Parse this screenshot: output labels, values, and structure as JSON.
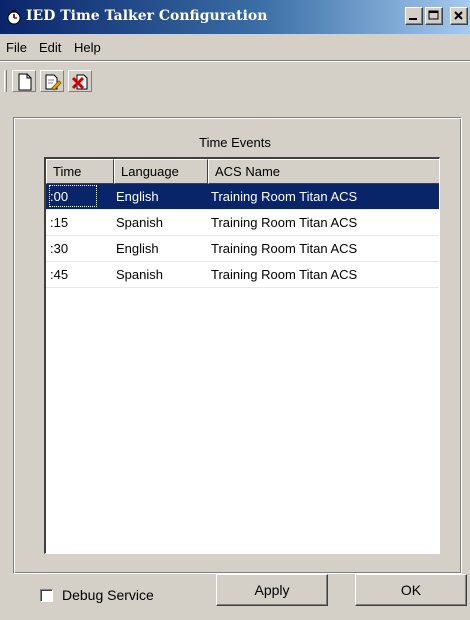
{
  "window": {
    "title": "IED Time Talker Configuration",
    "icon": "clock-app-icon",
    "controls": [
      "minimize",
      "maximize",
      "close"
    ]
  },
  "menu": [
    "File",
    "Edit",
    "Help"
  ],
  "toolbar": {
    "buttons": [
      "new-document-icon",
      "edit-document-icon",
      "delete-document-icon"
    ]
  },
  "events": {
    "title": "Time Events",
    "columns": [
      "Time",
      "Language",
      "ACS Name"
    ],
    "rows": [
      {
        "time": ":00",
        "language": "English",
        "acs": "Training Room Titan ACS",
        "selected": true
      },
      {
        "time": ":15",
        "language": "Spanish",
        "acs": "Training Room Titan ACS",
        "selected": false
      },
      {
        "time": ":30",
        "language": "English",
        "acs": "Training Room Titan ACS",
        "selected": false
      },
      {
        "time": ":45",
        "language": "Spanish",
        "acs": "Training Room Titan ACS",
        "selected": false
      }
    ]
  },
  "footer": {
    "debug_label": "Debug Service",
    "debug_checked": false,
    "apply_label": "Apply",
    "ok_label": "OK"
  },
  "colors": {
    "selection": "#0a246a",
    "face": "#d4d0c8"
  }
}
